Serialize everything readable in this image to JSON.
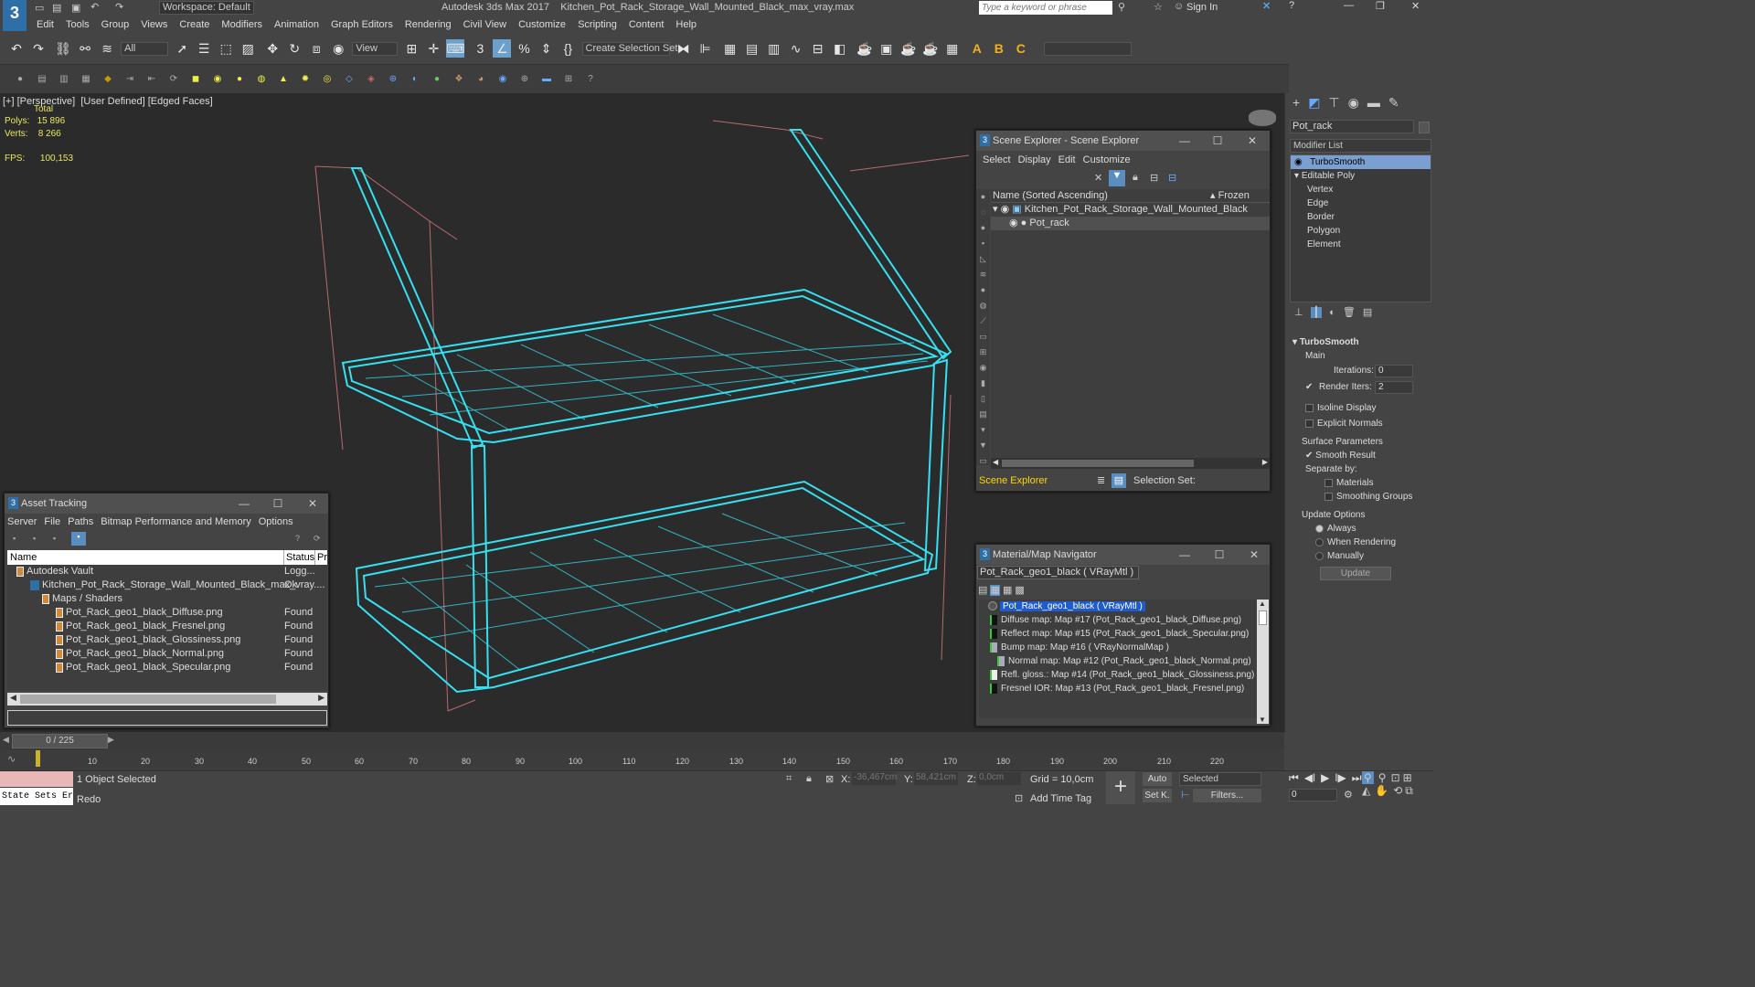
{
  "app": {
    "title": "Autodesk 3ds Max 2017",
    "file": "Kitchen_Pot_Rack_Storage_Wall_Mounted_Black_max_vray.max",
    "workspace": "Workspace: Default",
    "search_placeholder": "Type a keyword or phrase",
    "signin": "Sign In"
  },
  "menus": [
    "Edit",
    "Tools",
    "Group",
    "Views",
    "Create",
    "Modifiers",
    "Animation",
    "Graph Editors",
    "Rendering",
    "Civil View",
    "Customize",
    "Scripting",
    "Content",
    "Help"
  ],
  "toolbar": {
    "filter": "All",
    "refcoord": "View",
    "selset": "Create Selection Set"
  },
  "viewport": {
    "label_plus": "[+]",
    "label_view": "[Perspective]",
    "label_shade": "[User Defined]",
    "label_edge": "[Edged Faces]",
    "stats_total": "Total",
    "polys_label": "Polys:",
    "polys": "15 896",
    "verts_label": "Verts:",
    "verts": "8 266",
    "fps_label": "FPS:",
    "fps": "100,153"
  },
  "scene_explorer": {
    "title": "Scene Explorer - Scene Explorer",
    "menu": [
      "Select",
      "Display",
      "Edit",
      "Customize"
    ],
    "col_name": "Name (Sorted Ascending)",
    "col_frozen": "▴ Frozen",
    "items": [
      "Kitchen_Pot_Rack_Storage_Wall_Mounted_Black",
      "Pot_rack"
    ],
    "footer_name": "Scene Explorer",
    "footer_sel": "Selection Set:"
  },
  "asset_tracking": {
    "title": "Asset Tracking",
    "menu": [
      "Server",
      "File",
      "Paths",
      "Bitmap Performance and Memory",
      "Options"
    ],
    "col_name": "Name",
    "col_status": "Status",
    "col_pr": "Pro",
    "rows": [
      {
        "name": "Autodesk Vault",
        "status": "Logg..."
      },
      {
        "name": "Kitchen_Pot_Rack_Storage_Wall_Mounted_Black_max_vray....",
        "status": "Ok"
      },
      {
        "name": "Maps / Shaders",
        "status": ""
      },
      {
        "name": "Pot_Rack_geo1_black_Diffuse.png",
        "status": "Found"
      },
      {
        "name": "Pot_Rack_geo1_black_Fresnel.png",
        "status": "Found"
      },
      {
        "name": "Pot_Rack_geo1_black_Glossiness.png",
        "status": "Found"
      },
      {
        "name": "Pot_Rack_geo1_black_Normal.png",
        "status": "Found"
      },
      {
        "name": "Pot_Rack_geo1_black_Specular.png",
        "status": "Found"
      }
    ]
  },
  "material_nav": {
    "title": "Material/Map Navigator",
    "field": "Pot_Rack_geo1_black  ( VRayMtl )",
    "items": [
      "Pot_Rack_geo1_black  ( VRayMtl )",
      "Diffuse map: Map #17 (Pot_Rack_geo1_black_Diffuse.png)",
      "Reflect map: Map #15 (Pot_Rack_geo1_black_Specular.png)",
      "Bump map: Map #16  ( VRayNormalMap )",
      "Normal map: Map #12 (Pot_Rack_geo1_black_Normal.png)",
      "Refl. gloss.: Map #14 (Pot_Rack_geo1_black_Glossiness.png)",
      "Fresnel IOR: Map #13 (Pot_Rack_geo1_black_Fresnel.png)"
    ]
  },
  "cmd": {
    "object_name": "Pot_rack",
    "modlist": "Modifier List",
    "stack": [
      "TurboSmooth",
      "Editable Poly",
      "Vertex",
      "Edge",
      "Border",
      "Polygon",
      "Element"
    ],
    "rollout": "TurboSmooth",
    "main": "Main",
    "iterations_label": "Iterations:",
    "iterations": "0",
    "render_iters_label": "Render Iters:",
    "render_iters": "2",
    "isoline": "Isoline Display",
    "explicit": "Explicit Normals",
    "surface": "Surface Parameters",
    "smooth": "Smooth Result",
    "separate": "Separate by:",
    "materials": "Materials",
    "smoothing": "Smoothing Groups",
    "update_opts": "Update Options",
    "always": "Always",
    "when_render": "When Rendering",
    "manually": "Manually",
    "update_btn": "Update"
  },
  "timeline": {
    "frame": "0 / 225",
    "ticks": [
      "10",
      "20",
      "30",
      "40",
      "50",
      "60",
      "70",
      "80",
      "90",
      "100",
      "110",
      "120",
      "130",
      "140",
      "150",
      "160",
      "170",
      "180",
      "190",
      "200",
      "210",
      "220"
    ]
  },
  "status": {
    "state_sets": "State Sets Er",
    "selected": "1 Object Selected",
    "redo": "Redo",
    "x_label": "X:",
    "x": "-36,467cm",
    "y_label": "Y:",
    "y": "58,421cm",
    "z_label": "Z:",
    "z": "0,0cm",
    "grid": "Grid = 10,0cm",
    "add_tag": "Add Time Tag",
    "auto": "Auto",
    "set_k": "Set K.",
    "selected_drop": "Selected",
    "filters": "Filters...",
    "frame_field": "0"
  }
}
